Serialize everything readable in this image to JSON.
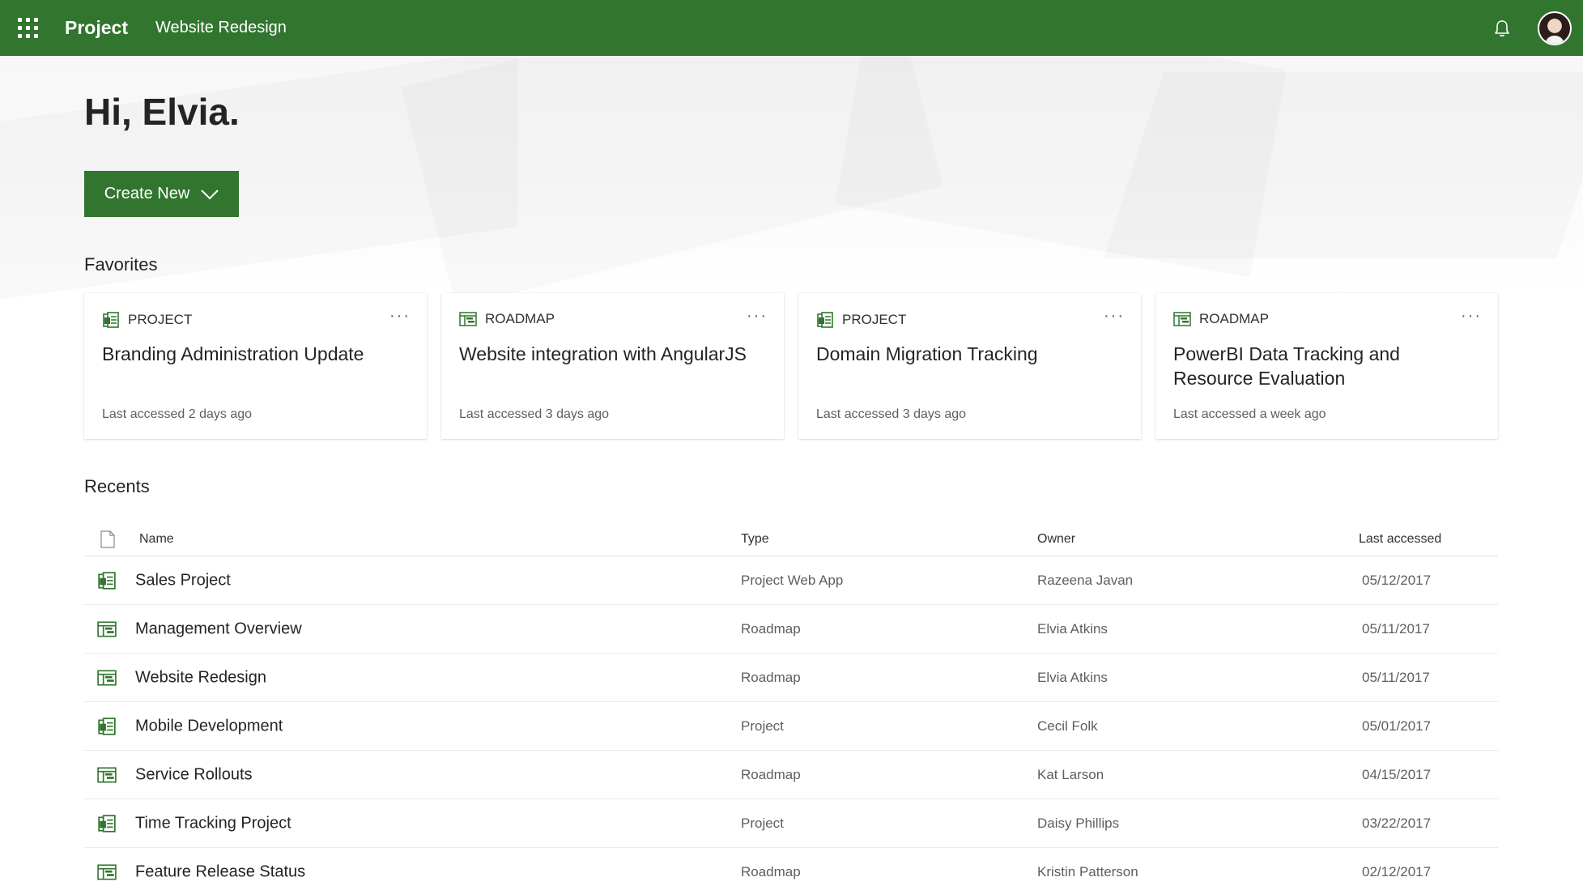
{
  "topbar": {
    "app_name": "Project",
    "project_name": "Website Redesign",
    "icons": {
      "waffle": "waffle-icon",
      "notifications": "bell-icon",
      "profile": "avatar"
    },
    "color": "#31752f"
  },
  "greeting": "Hi, Elvia.",
  "create_button": {
    "label": "Create New",
    "icon": "chevron-down-icon"
  },
  "favorites": {
    "title": "Favorites",
    "cards": [
      {
        "type": "PROJECT",
        "icon": "project-icon",
        "title": "Branding Administration Update",
        "meta": "Last accessed 2 days ago"
      },
      {
        "type": "ROADMAP",
        "icon": "roadmap-icon",
        "title": "Website integration with AngularJS",
        "meta": "Last accessed 3 days ago"
      },
      {
        "type": "PROJECT",
        "icon": "project-icon",
        "title": "Domain Migration Tracking",
        "meta": "Last accessed 3 days ago"
      },
      {
        "type": "ROADMAP",
        "icon": "roadmap-icon",
        "title": "PowerBI Data Tracking and Resource Evaluation",
        "meta": "Last accessed a week ago"
      }
    ],
    "more_label": "···"
  },
  "recents": {
    "title": "Recents",
    "columns": {
      "icon": "file-icon",
      "name": "Name",
      "type": "Type",
      "owner": "Owner",
      "last_accessed": "Last accessed"
    },
    "rows": [
      {
        "icon": "project-icon",
        "name": "Sales Project",
        "type": "Project Web App",
        "owner": "Razeena Javan",
        "date": "05/12/2017"
      },
      {
        "icon": "roadmap-icon",
        "name": "Management Overview",
        "type": "Roadmap",
        "owner": "Elvia Atkins",
        "date": "05/11/2017"
      },
      {
        "icon": "roadmap-icon",
        "name": "Website Redesign",
        "type": "Roadmap",
        "owner": "Elvia Atkins",
        "date": "05/11/2017"
      },
      {
        "icon": "project-icon",
        "name": "Mobile Development",
        "type": "Project",
        "owner": "Cecil Folk",
        "date": "05/01/2017"
      },
      {
        "icon": "roadmap-icon",
        "name": "Service Rollouts",
        "type": "Roadmap",
        "owner": "Kat Larson",
        "date": "04/15/2017"
      },
      {
        "icon": "project-icon",
        "name": "Time Tracking Project",
        "type": "Project",
        "owner": "Daisy Phillips",
        "date": "03/22/2017"
      },
      {
        "icon": "roadmap-icon",
        "name": "Feature Release Status",
        "type": "Roadmap",
        "owner": "Kristin Patterson",
        "date": "02/12/2017"
      }
    ]
  }
}
